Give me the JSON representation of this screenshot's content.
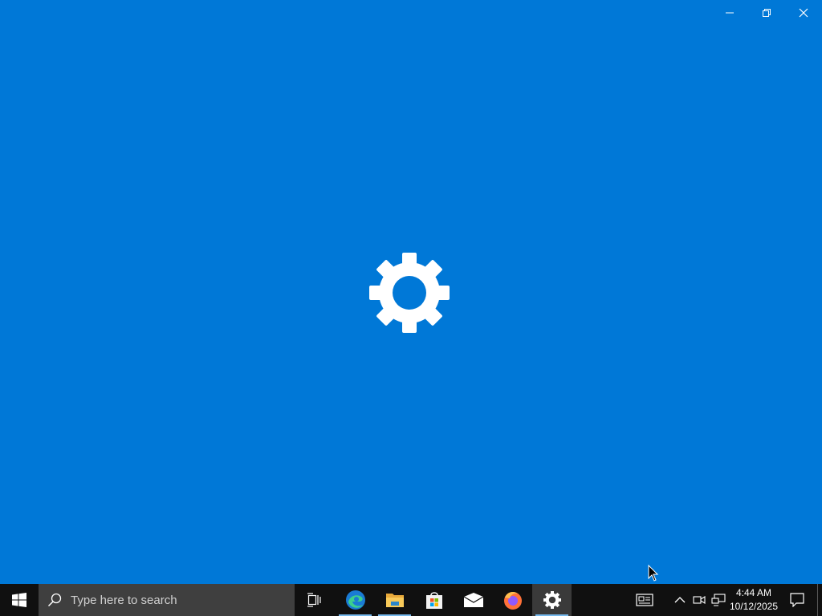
{
  "window": {
    "title": "Settings",
    "splash_background": "#0078d7",
    "icon": "gear-icon",
    "controls": {
      "minimize": "minimize-icon",
      "restore": "restore-icon",
      "close": "close-icon"
    }
  },
  "taskbar": {
    "search_placeholder": "Type here to search",
    "pinned_apps": [
      {
        "name": "Task View",
        "icon": "task-view-icon"
      },
      {
        "name": "Microsoft Edge",
        "icon": "edge-icon"
      },
      {
        "name": "File Explorer",
        "icon": "folder-icon"
      },
      {
        "name": "Microsoft Store",
        "icon": "store-icon"
      },
      {
        "name": "Mail",
        "icon": "mail-icon"
      },
      {
        "name": "Firefox",
        "icon": "firefox-icon"
      },
      {
        "name": "Settings",
        "icon": "gear-icon"
      }
    ],
    "tray": {
      "news_icon": "news-icon",
      "chevron_icon": "chevron-up-icon",
      "meet_icon": "meet-now-icon",
      "network_icon": "network-icon",
      "time": "4:44 AM",
      "date": "10/12/2025",
      "notification_icon": "action-center-icon"
    },
    "accent_color": "#76b9ed"
  }
}
